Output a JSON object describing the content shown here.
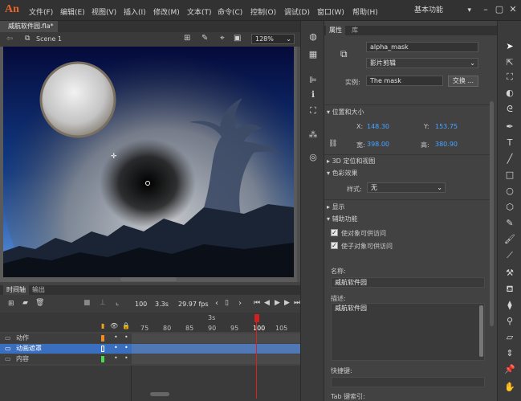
{
  "app": {
    "logo": "An",
    "menu": [
      "文件(F)",
      "编辑(E)",
      "视图(V)",
      "插入(I)",
      "修改(M)",
      "文本(T)",
      "命令(C)",
      "控制(O)",
      "调试(D)",
      "窗口(W)",
      "帮助(H)"
    ],
    "workspace": "基本功能"
  },
  "document": {
    "tab_title": "威航软件园.fla*",
    "scene": "Scene 1",
    "zoom": "128%"
  },
  "timeline": {
    "tabs": [
      "时间轴",
      "输出"
    ],
    "frame_current": "100",
    "time": "3.3s",
    "fps": "29.97 fps",
    "ruler_sec": "3s",
    "frame_ticks": [
      "75",
      "80",
      "85",
      "90",
      "95",
      "100",
      "105"
    ],
    "layers": [
      {
        "name": "动作",
        "color": "#f08a24"
      },
      {
        "name": "动画遮罩",
        "color": "#3d7de0"
      },
      {
        "name": "内容",
        "color": "#4ed84e"
      }
    ]
  },
  "properties": {
    "tabs": [
      "属性",
      "库"
    ],
    "instance_name": "alpha_mask",
    "symbol_type": "影片剪辑",
    "instance_label": "实例:",
    "instance_of": "The mask",
    "swap_button": "交换 ...",
    "pos_size": {
      "header": "位置和大小",
      "x_label": "X:",
      "x": "148.30",
      "y_label": "Y:",
      "y": "153.75",
      "w_label": "宽:",
      "w": "398.00",
      "h_label": "高:",
      "h": "380.90"
    },
    "section_3d": "3D 定位和视图",
    "color_effect": {
      "header": "色彩效果",
      "style_label": "样式:",
      "style_value": "无"
    },
    "display_header": "显示",
    "accessibility": {
      "header": "辅助功能",
      "check1": "使对象可供访问",
      "check2": "使子对象可供访问",
      "name_label": "名称:",
      "name_value": "威航软件园",
      "desc_label": "描述:",
      "desc_value": "威航软件园",
      "shortcut_label": "快捷键:",
      "tab_index_label": "Tab 键索引:"
    }
  }
}
